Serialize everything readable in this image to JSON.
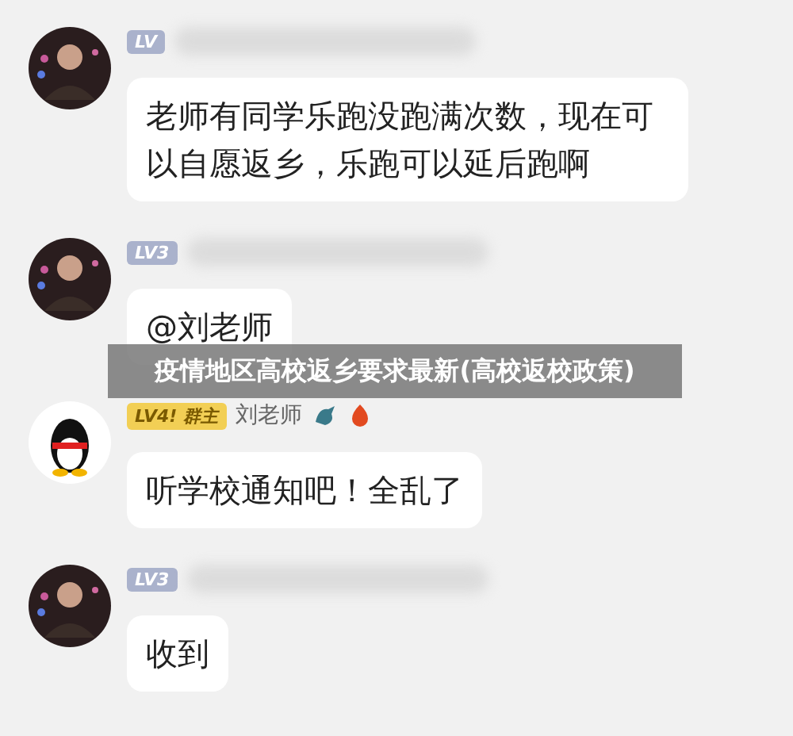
{
  "messages": [
    {
      "avatar": {
        "kind": "person"
      },
      "badge": {
        "kind": "level",
        "text": "LV"
      },
      "text": "老师有同学乐跑没跑满次数，现在可以自愿返乡，乐跑可以延后跑啊"
    },
    {
      "avatar": {
        "kind": "person"
      },
      "badge": {
        "kind": "level",
        "text": "LV3"
      },
      "text": "@刘老师"
    },
    {
      "avatar": {
        "kind": "penguin"
      },
      "badge": {
        "kind": "owner",
        "text": "LV4! 群主"
      },
      "name": "刘老师",
      "text": "听学校通知吧！全乱了"
    },
    {
      "avatar": {
        "kind": "person"
      },
      "badge": {
        "kind": "level",
        "text": "LV3"
      },
      "text": "收到"
    }
  ],
  "overlay_title": "疫情地区高校返乡要求最新(高校返校政策)"
}
